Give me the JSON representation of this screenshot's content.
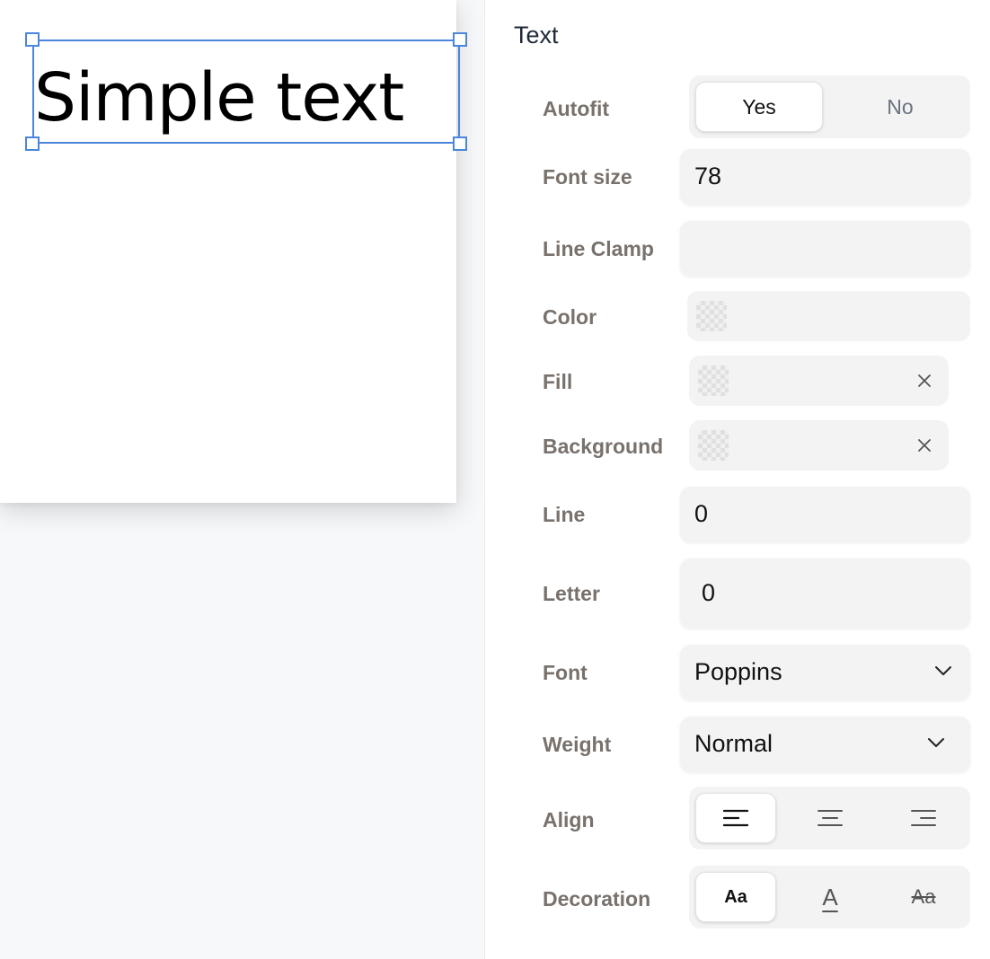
{
  "canvas": {
    "text_content": "Simple text"
  },
  "panel": {
    "title": "Text",
    "autofit": {
      "label": "Autofit",
      "options": [
        "Yes",
        "No"
      ],
      "selected": "Yes"
    },
    "font_size": {
      "label": "Font size",
      "value": "78"
    },
    "line_clamp": {
      "label": "Line Clamp",
      "value": ""
    },
    "color": {
      "label": "Color",
      "icon": "transparent-swatch-icon"
    },
    "fill": {
      "label": "Fill",
      "icon": "transparent-swatch-icon",
      "clear_icon": "close-icon"
    },
    "background": {
      "label": "Background",
      "icon": "transparent-swatch-icon",
      "clear_icon": "close-icon"
    },
    "line": {
      "label": "Line",
      "value": "0"
    },
    "letter": {
      "label": "Letter",
      "value": "0"
    },
    "font": {
      "label": "Font",
      "value": "Poppins",
      "icon": "chevron-down-icon"
    },
    "weight": {
      "label": "Weight",
      "value": "Normal",
      "icon": "chevron-down-icon"
    },
    "align": {
      "label": "Align",
      "options": [
        "align-left-icon",
        "align-center-icon",
        "align-right-icon"
      ],
      "selected": "align-left-icon"
    },
    "decoration": {
      "label": "Decoration",
      "options": [
        "Aa",
        "A",
        "Aa"
      ],
      "icons": [
        "no-decoration-icon",
        "underline-icon",
        "strikethrough-icon"
      ],
      "selected": "no-decoration-icon"
    }
  },
  "colors": {
    "selection": "#4a86dc",
    "label": "#78716c",
    "field_bg": "#f3f3f3",
    "canvas_bg": "#f7f8fa"
  }
}
